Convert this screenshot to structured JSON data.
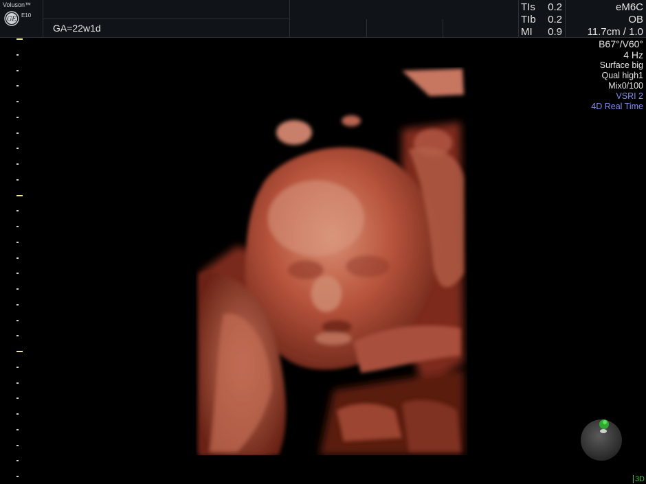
{
  "header": {
    "brand": "Voluson™",
    "model": "E10",
    "logo_icon": "ge-logo-icon",
    "gestational_age": "GA=22w1d",
    "safety": [
      {
        "label": "TIs",
        "value": "0.2"
      },
      {
        "label": "TIb",
        "value": "0.2"
      },
      {
        "label": "MI",
        "value": "0.9"
      }
    ],
    "probe": "eM6C",
    "preset": "OB",
    "depth_zoom": "11.7cm / 1.0"
  },
  "params": {
    "angles": "B67°/V60°",
    "frame_rate": "4 Hz",
    "render_mode": "Surface big",
    "quality": "Qual high1",
    "mix": "Mix0/100",
    "vsri": "VSRI 2",
    "realtime": "4D Real Time"
  },
  "mode_indicator": "3D",
  "colors": {
    "background": "#000000",
    "header": "#101418",
    "mode_text": "#7f8cf0",
    "indicator_green": "#39c43a",
    "tissue_base": "#b8503a"
  },
  "icons": {
    "orientation": "orientation-ball-icon"
  }
}
